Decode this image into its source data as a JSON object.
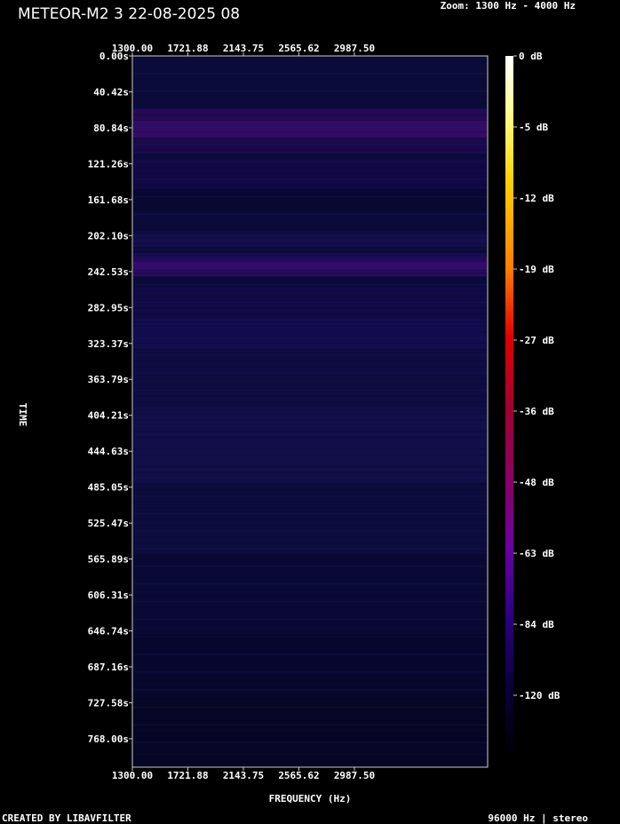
{
  "header": {
    "title": "METEOR-M2 3 22-08-2025 08",
    "zoom": "Zoom: 1300 Hz - 4000 Hz"
  },
  "footer": {
    "left": "CREATED BY LIBAVFILTER",
    "right": "96000 Hz | stereo"
  },
  "chart_data": {
    "type": "heatmap",
    "xlabel": "FREQUENCY (Hz)",
    "ylabel": "TIME",
    "xlim": [
      1300,
      4000
    ],
    "ylim": [
      0,
      800
    ],
    "x_ticks": [
      "1300.00",
      "1721.88",
      "2143.75",
      "2565.62",
      "2987.50"
    ],
    "x_tick_values": [
      1300,
      1721.88,
      2143.75,
      2565.62,
      2987.5
    ],
    "y_ticks": [
      "0.00s",
      "40.42s",
      "80.84s",
      "121.26s",
      "161.68s",
      "202.10s",
      "242.53s",
      "282.95s",
      "323.37s",
      "363.79s",
      "404.21s",
      "444.63s",
      "485.05s",
      "525.47s",
      "565.89s",
      "606.31s",
      "646.74s",
      "687.16s",
      "727.58s",
      "768.00s"
    ],
    "y_tick_values": [
      0,
      40.42,
      80.84,
      121.26,
      161.68,
      202.1,
      242.53,
      282.95,
      323.37,
      363.79,
      404.21,
      444.63,
      485.05,
      525.47,
      565.89,
      606.31,
      646.74,
      687.16,
      727.58,
      768.0
    ],
    "colorbar_labels": [
      "0 dB",
      "-5 dB",
      "-12 dB",
      "-19 dB",
      "-27 dB",
      "-36 dB",
      "-48 dB",
      "-63 dB",
      "-84 dB",
      "-120 dB"
    ],
    "colorbar_values": [
      0,
      -5,
      -12,
      -19,
      -27,
      -36,
      -48,
      -63,
      -84,
      -120
    ],
    "colormap": [
      "#ffffff",
      "#ffff90",
      "#ffd000",
      "#ff8000",
      "#e00000",
      "#a00030",
      "#8a0060",
      "#6a00a0",
      "#2a0080",
      "#08003a",
      "#000000"
    ],
    "background_color": "#0b0b3a"
  }
}
